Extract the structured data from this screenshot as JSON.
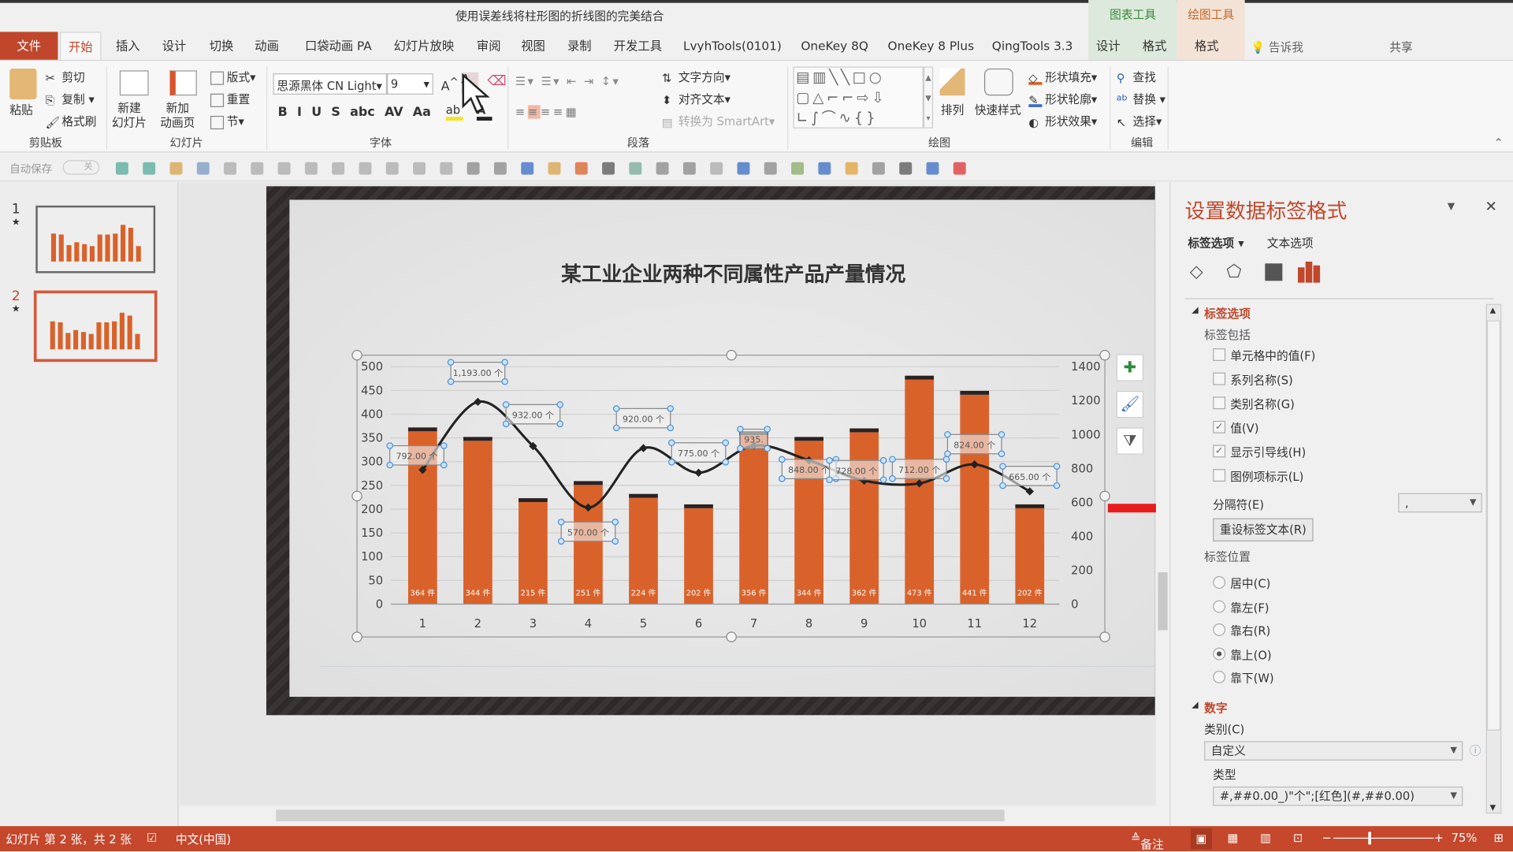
{
  "window": {
    "title": "使用误差线将柱形图的折线图的完美结合",
    "context_tabs": [
      {
        "label": "图表工具",
        "color": "#3a8a3a",
        "bg": "#dde9dc"
      },
      {
        "label": "绘图工具",
        "color": "#c0672b",
        "bg": "#f3e3d6"
      }
    ]
  },
  "tabs": [
    "文件",
    "开始",
    "插入",
    "设计",
    "切换",
    "动画",
    "口袋动画 PA",
    "幻灯片放映",
    "审阅",
    "视图",
    "录制",
    "开发工具",
    "LvyhTools(0101)",
    "OneKey 8Q",
    "OneKey 8 Plus",
    "QingTools 3.3",
    "设计",
    "格式",
    "格式"
  ],
  "tell_me": "告诉我",
  "share": "共享",
  "ribbon": {
    "clipboard": {
      "paste": "粘贴",
      "cut": "剪切",
      "copy": "复制",
      "format_painter": "格式刷",
      "label": "剪贴板"
    },
    "slides": {
      "new_slide": "新建\n幻灯片",
      "new_anim": "新加\n动画页",
      "layout": "版式",
      "reset": "重置",
      "section": "节",
      "label": "幻灯片"
    },
    "font": {
      "name": "思源黑体 CN Light",
      "size": "9",
      "label": "字体",
      "buttons": [
        "B",
        "I",
        "U",
        "S",
        "abc",
        "AV",
        "Aa"
      ]
    },
    "paragraph": {
      "text_direction": "文字方向",
      "align_text": "对齐文本",
      "smartart": "转换为 SmartArt",
      "label": "段落"
    },
    "drawing": {
      "arrange": "排列",
      "quick_styles": "快速样式",
      "fill": "形状填充",
      "outline": "形状轮廓",
      "effects": "形状效果",
      "label": "绘图"
    },
    "editing": {
      "find": "查找",
      "replace": "替换",
      "select": "选择",
      "label": "编辑"
    }
  },
  "qat": {
    "autosave": "自动保存",
    "autosave_state": "关"
  },
  "slides_panel": [
    {
      "num": "1"
    },
    {
      "num": "2",
      "selected": true
    }
  ],
  "slide": {
    "title": "某工业企业两种不同属性产品产量情况"
  },
  "chart_data": {
    "type": "bar+line",
    "categories": [
      "1",
      "2",
      "3",
      "4",
      "5",
      "6",
      "7",
      "8",
      "9",
      "10",
      "11",
      "12"
    ],
    "series": [
      {
        "type": "bar",
        "axis": "left",
        "values": [
          364,
          344,
          215,
          251,
          224,
          202,
          356,
          344,
          362,
          473,
          441,
          202
        ],
        "labels": [
          "364 件",
          "344 件",
          "215 件",
          "251 件",
          "224 件",
          "202 件",
          "356 件",
          "344 件",
          "362 件",
          "473 件",
          "441 件",
          "202 件"
        ],
        "color": "#d9622b"
      },
      {
        "type": "line",
        "axis": "right",
        "smooth": true,
        "values": [
          792,
          1193,
          932,
          570,
          920,
          775,
          935,
          848,
          728,
          712,
          824,
          665
        ],
        "labels": [
          "792.00 个",
          "1,193.00 个",
          "932.00 个",
          "570.00 个",
          "920.00 个",
          "775.00 个",
          "935.",
          "848.00 个",
          "728.00 个",
          "712.00 个",
          "824.00 个",
          "665.00 个"
        ],
        "color": "#222222"
      }
    ],
    "y_left": {
      "range": [
        0,
        500
      ],
      "ticks": [
        "0",
        "50",
        "100",
        "150",
        "200",
        "250",
        "300",
        "350",
        "400",
        "450",
        "500"
      ]
    },
    "y_right": {
      "range": [
        0,
        1400
      ],
      "ticks": [
        "0",
        "200",
        "400",
        "600",
        "800",
        "1000",
        "1200",
        "1400"
      ]
    },
    "grid": true
  },
  "panel": {
    "title": "设置数据标签格式",
    "tab_label_options": "标签选项",
    "tab_text_options": "文本选项",
    "section_label_options": "标签选项",
    "label_contains": "标签包括",
    "checkboxes": [
      {
        "label": "单元格中的值(F)",
        "checked": false
      },
      {
        "label": "系列名称(S)",
        "checked": false
      },
      {
        "label": "类别名称(G)",
        "checked": false
      },
      {
        "label": "值(V)",
        "checked": true
      },
      {
        "label": "显示引导线(H)",
        "checked": true
      },
      {
        "label": "图例项标示(L)",
        "checked": false
      }
    ],
    "separator_label": "分隔符(E)",
    "separator_value": ",",
    "reset_button": "重设标签文本(R)",
    "label_position": "标签位置",
    "radios": [
      {
        "label": "居中(C)",
        "checked": false
      },
      {
        "label": "靠左(F)",
        "checked": false
      },
      {
        "label": "靠右(R)",
        "checked": false
      },
      {
        "label": "靠上(O)",
        "checked": true
      },
      {
        "label": "靠下(W)",
        "checked": false
      }
    ],
    "section_number": "数字",
    "category_label": "类别(C)",
    "category_value": "自定义",
    "type_label": "类型",
    "type_value": "#,##0.00_)\"个\";[红色](#,##0.00)",
    "accent": "#c0472b"
  },
  "status": {
    "slide_info": "幻灯片 第 2 张，共 2 张",
    "language": "中文(中国)",
    "notes": "备注",
    "zoom": "75%",
    "zoom_percent": 75
  }
}
